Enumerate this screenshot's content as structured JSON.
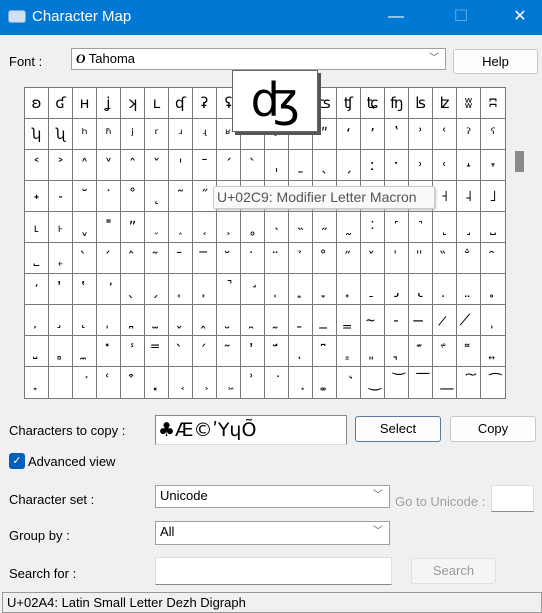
{
  "window": {
    "title": "Character Map",
    "minimize": "—",
    "maximize": "☐",
    "close": "✕",
    "accent": "#0078d4"
  },
  "font": {
    "label": "Font :",
    "value": "Tahoma",
    "font_icon": "O",
    "help": "Help"
  },
  "grid": {
    "rows": [
      [
        "ʚ",
        "ʛ",
        "ʜ",
        "ʝ",
        "ʞ",
        "ʟ",
        "ʠ",
        "ʡ",
        "ʢ",
        "ʣ",
        "ʤ",
        "ʥ",
        "ʦ",
        "ʧ",
        "ʨ",
        "ʩ",
        "ʪ",
        "ʫ",
        "ʬ",
        "ʭ"
      ],
      [
        "ʮ",
        "ʯ",
        "ʰ",
        "ʱ",
        "ʲ",
        "ʳ",
        "ʴ",
        "ʵ",
        "ʶ",
        "ʷ",
        "ʸ",
        "ʹ",
        "ʺ",
        "ʻ",
        "ʼ",
        "ʽ",
        "ʾ",
        "ʿ",
        "ˀ",
        "ˁ"
      ],
      [
        "˂",
        "˃",
        "˄",
        "˅",
        "ˆ",
        "ˇ",
        "ˈ",
        "ˉ",
        "ˊ",
        "ˋ",
        "ˌ",
        "ˍ",
        "ˎ",
        "ˏ",
        "ː",
        "ˑ",
        "˒",
        "˓",
        "˔",
        "˕"
      ],
      [
        "˖",
        "˗",
        "˘",
        "˙",
        "˚",
        "˛",
        "˜",
        "˝",
        "˞",
        "˟",
        "ˠ",
        "ˡ",
        "ˢ",
        "ˣ",
        "ˤ",
        "˥",
        "˦",
        "˧",
        "˨",
        "˩"
      ],
      [
        "˪",
        "˫",
        "ˬ",
        "˭",
        "ˮ",
        "˯",
        "˰",
        "˱",
        "˲",
        "˳",
        "˴",
        "˵",
        "˶",
        "˷",
        "˸",
        "˹",
        "˺",
        "˻",
        "˼",
        "˽"
      ],
      [
        "˾",
        "˿",
        " ̀",
        " ́",
        " ̂",
        " ̃",
        " ̄",
        " ̅",
        " ̆",
        " ̇",
        " ̈",
        " ̉",
        " ̊",
        " ̋",
        " ̌",
        " ̍",
        " ̎",
        " ̏",
        " ̐",
        " ̑"
      ],
      [
        " ̒",
        " ̓",
        " ̔",
        " ̕",
        " ̖",
        " ̗",
        " ̘",
        " ̙",
        " ̚",
        " ̛",
        " ̜",
        " ̝",
        " ̞",
        " ̟",
        " ̠",
        " ̡",
        " ̢",
        " ̣",
        " ̤",
        " ̥"
      ],
      [
        " ̦",
        " ̧",
        " ̨",
        " ̩",
        " ̪",
        " ̫",
        " ̬",
        " ̭",
        " ̮",
        " ̯",
        " ̰",
        " ̱",
        " ̲",
        " ̳",
        " ̴",
        " ̵",
        " ̶",
        " ̷",
        " ̸",
        " ̹"
      ],
      [
        " ̺",
        " ̻",
        " ̼",
        " ̽",
        " ̾",
        " ̿",
        " ̀",
        " ́",
        " ͂",
        " ̓",
        " ̈́",
        " ͅ",
        " ͆",
        " ͇",
        " ͈",
        " ͉",
        " ͊",
        " ͋",
        " ͌",
        " ͍"
      ],
      [
        " ͎",
        " ͏",
        " ͐",
        " ͑",
        " ͒",
        " ͓",
        " ͔",
        " ͕",
        " ͖",
        " ͗",
        " ͘",
        " ͙",
        " ͚",
        " ͛",
        " ͜",
        " ͝",
        " ͞",
        " ͟",
        " ͠",
        " ͡"
      ]
    ],
    "enlarged_char": "ʤ",
    "tooltip": "U+02C9: Modifier Letter Macron"
  },
  "copy": {
    "label": "Characters to copy :",
    "value": "♣Æ©ʹYɥÕ",
    "select": "Select",
    "copy": "Copy"
  },
  "advanced_view": {
    "label": "Advanced view",
    "checked": true
  },
  "charset": {
    "label": "Character set :",
    "value": "Unicode",
    "goto_label": "Go to Unicode :",
    "goto_value": ""
  },
  "groupby": {
    "label": "Group by :",
    "value": "All"
  },
  "search": {
    "label": "Search for :",
    "value": "",
    "button": "Search"
  },
  "status": "U+02A4: Latin Small Letter Dezh Digraph"
}
